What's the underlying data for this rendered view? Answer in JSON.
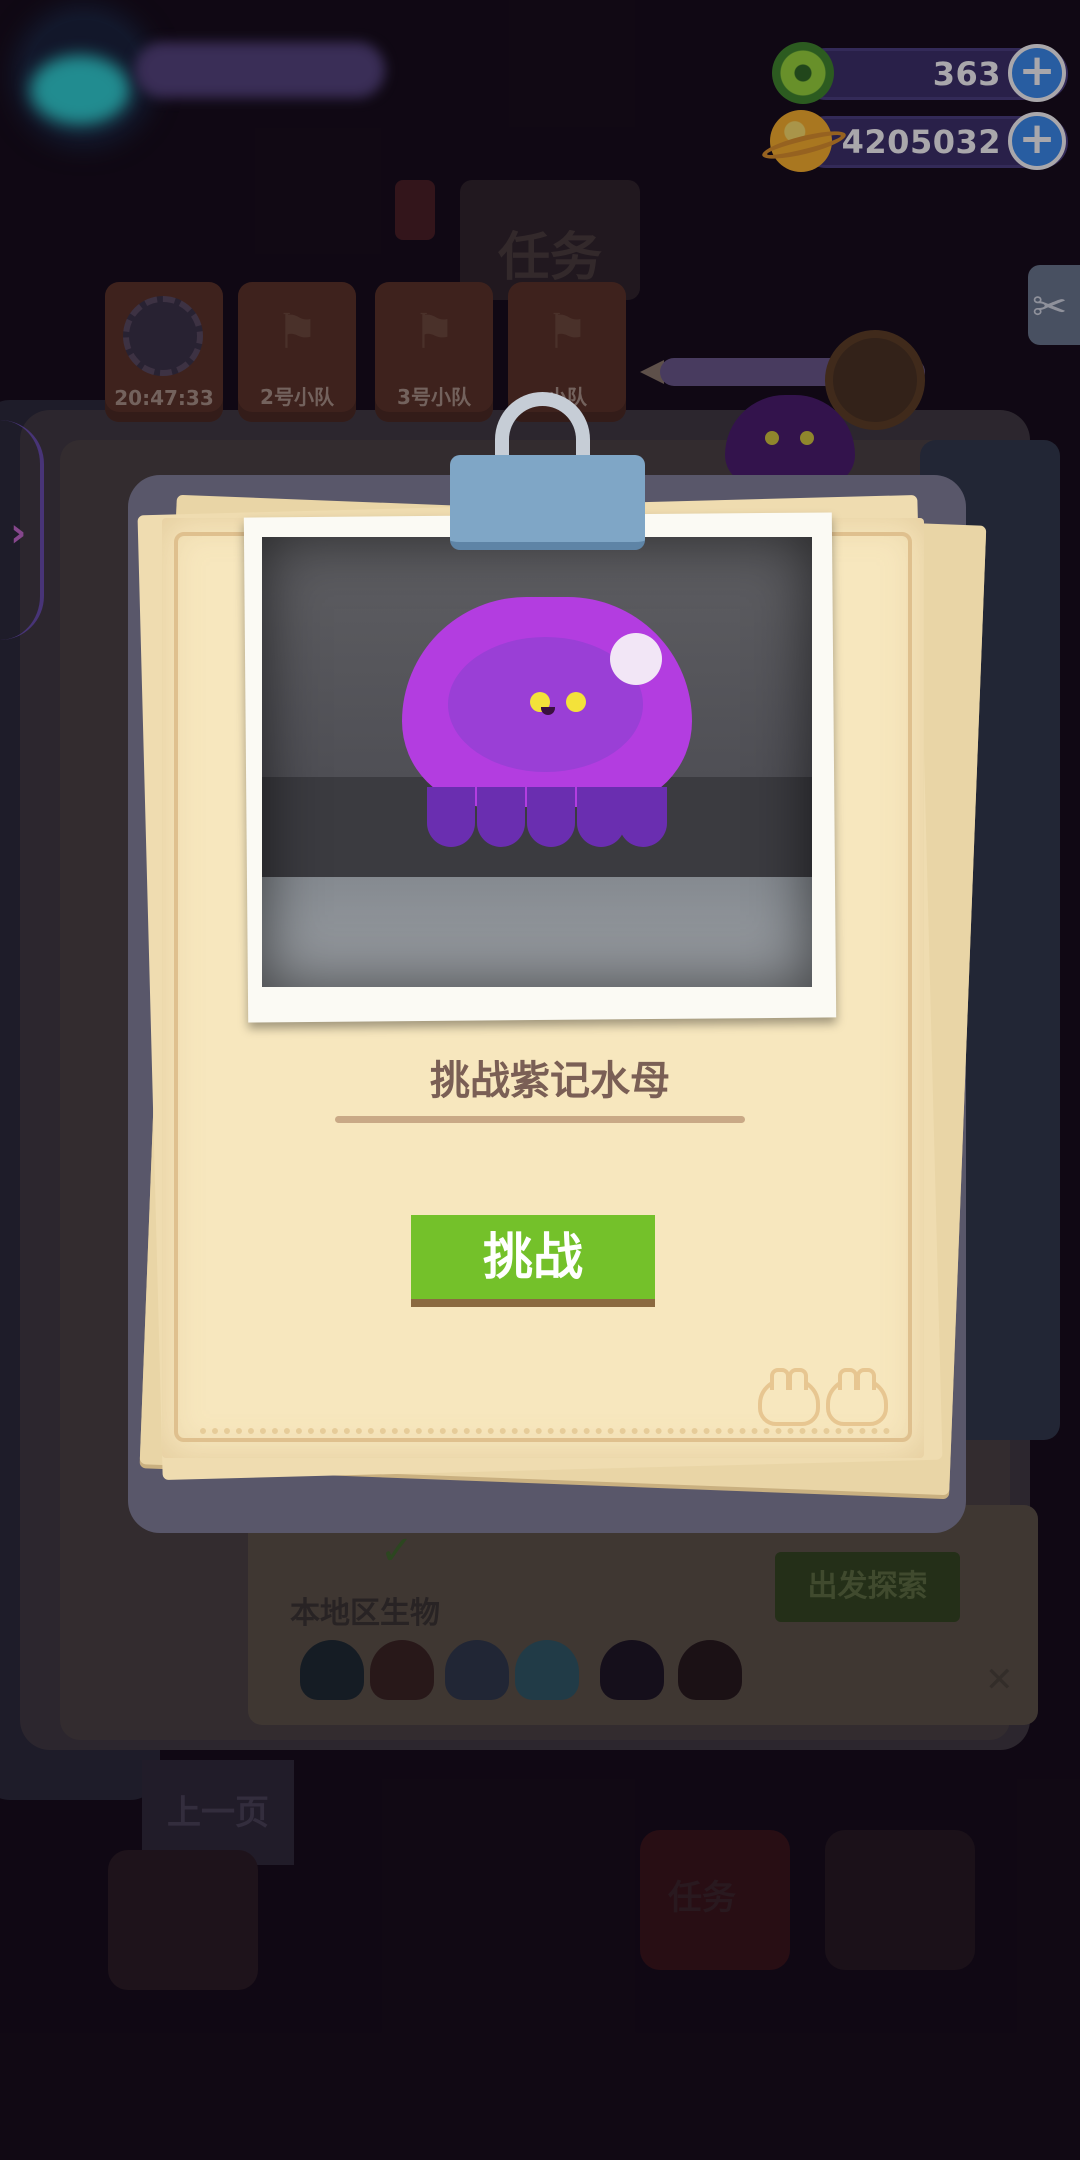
{
  "hud": {
    "currency_green": "363",
    "currency_gold": "4205032"
  },
  "background": {
    "task_title": "任务",
    "team_cards": [
      "20:47:33",
      "2号小队",
      "3号小队",
      "小队"
    ],
    "region_label": "本地区生物",
    "go_button": "出发探索",
    "prev_page": "上一页",
    "bottom_tab_right": "任务"
  },
  "modal": {
    "title": "挑战紫记水母",
    "challenge_button": "挑战"
  },
  "colors": {
    "accent_green": "#74c12a",
    "jelly_purple": "#b33de0",
    "currency_bar": "#3b3169",
    "plus_blue": "#3a8ef0"
  },
  "icons": [
    "green-donut-icon",
    "planet-coin-icon",
    "plus-icon",
    "flag-icon",
    "scissors-icon",
    "check-icon",
    "binder-clip-icon",
    "bunny-doodle-icon"
  ]
}
